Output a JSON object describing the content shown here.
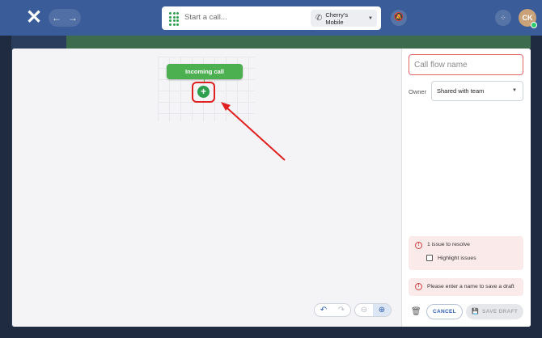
{
  "topbar": {
    "call_placeholder": "Start a call...",
    "line_name": "Cherry's Mobile",
    "avatar_initials": "CK"
  },
  "canvas": {
    "start_node_label": "Incoming call",
    "add_node_glyph": "+",
    "controls": [
      "undo-icon",
      "redo-icon",
      "zoom-out-icon",
      "zoom-in-icon"
    ]
  },
  "panel": {
    "name_placeholder": "Call flow name",
    "owner_label": "Owner",
    "owner_value": "Shared with team",
    "issue_title": "1 issue to resolve",
    "highlight_label": "Highlight issues",
    "name_warning": "Please enter a name to save a draft",
    "cancel_label": "CANCEL",
    "save_label": "SAVE DRAFT"
  },
  "colors": {
    "topbar": "#3a5c98",
    "accent_green": "#4caf50",
    "annotation_red": "#e02020",
    "error_bg": "#fbeaea",
    "link_blue": "#2f5fb3"
  }
}
